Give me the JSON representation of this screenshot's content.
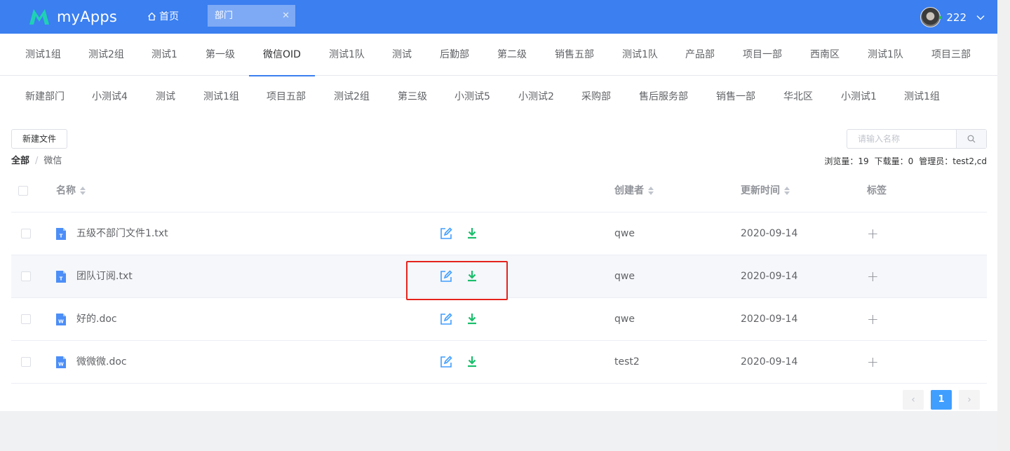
{
  "app": {
    "title": "myApps",
    "brand_color": "#3b7ff0"
  },
  "topbar": {
    "home_label": "首页",
    "open_tab": "部门",
    "open_tab_close": "✕",
    "user_name": "222"
  },
  "dept_tabs_row1": [
    "测试1组",
    "测试2组",
    "测试1",
    "第一级",
    "微信OID",
    "测试1队",
    "测试",
    "后勤部",
    "第二级",
    "销售五部",
    "测试1队",
    "产品部",
    "项目一部",
    "西南区",
    "测试1队",
    "项目三部"
  ],
  "dept_tabs_row2": [
    "新建部门",
    "小测试4",
    "测试",
    "测试1组",
    "项目五部",
    "测试2组",
    "第三级",
    "小测试5",
    "小测试2",
    "采购部",
    "售后服务部",
    "销售一部",
    "华北区",
    "小测试1",
    "测试1组"
  ],
  "active_dept": "微信OID",
  "toolbar": {
    "new_file_label": "新建文件",
    "search_placeholder": "请输入名称"
  },
  "breadcrumb": {
    "root": "全部",
    "separator": "/",
    "current": "微信"
  },
  "stats": {
    "views": "浏览量：19",
    "downloads": "下载量：0",
    "admin": "管理员：test2,cd"
  },
  "table": {
    "headers": {
      "name": "名称",
      "creator": "创建者",
      "updated": "更新时间",
      "tags": "标签"
    },
    "rows": [
      {
        "name": "五级不部门文件1.txt",
        "type": "txt",
        "creator": "qwe",
        "updated": "2020-09-14",
        "tag_action": "+"
      },
      {
        "name": "团队订阅.txt",
        "type": "txt",
        "creator": "qwe",
        "updated": "2020-09-14",
        "tag_action": "+"
      },
      {
        "name": "好的.doc",
        "type": "doc",
        "creator": "qwe",
        "updated": "2020-09-14",
        "tag_action": "+"
      },
      {
        "name": "微微微.doc",
        "type": "doc",
        "creator": "test2",
        "updated": "2020-09-14",
        "tag_action": "+"
      }
    ]
  },
  "pagination": {
    "prev": "‹",
    "current": "1",
    "next": "›"
  },
  "icons": {
    "edit": "edit-icon",
    "download": "download-icon",
    "txt_file": "txt-file-icon",
    "doc_file": "doc-file-icon",
    "search": "search-icon"
  },
  "colors": {
    "edit": "#409eff",
    "download": "#19be6b",
    "highlight": "#e5231c",
    "active_page": "#409eff"
  }
}
